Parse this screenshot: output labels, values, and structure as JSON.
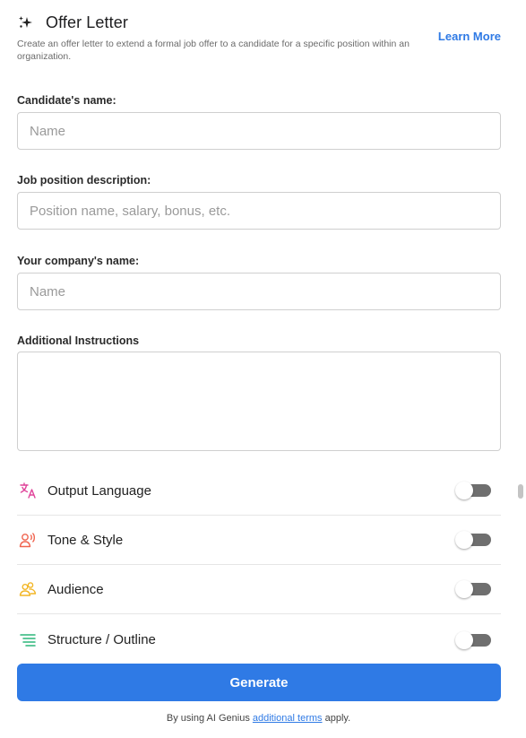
{
  "header": {
    "title": "Offer Letter",
    "subtitle": "Create an offer letter to extend a formal job offer to a candidate for a specific position within an organization.",
    "learn_more": "Learn More",
    "icon": "sparkle-icon"
  },
  "fields": {
    "candidate": {
      "label": "Candidate's name:",
      "placeholder": "Name",
      "value": ""
    },
    "position": {
      "label": "Job position description:",
      "placeholder": "Position name, salary, bonus, etc.",
      "value": ""
    },
    "company": {
      "label": "Your company's name:",
      "placeholder": "Name",
      "value": ""
    },
    "instructions": {
      "label": "Additional Instructions",
      "value": ""
    }
  },
  "options": [
    {
      "label": "Output Language",
      "icon": "translate-icon",
      "enabled": false
    },
    {
      "label": "Tone & Style",
      "icon": "voice-icon",
      "enabled": false
    },
    {
      "label": "Audience",
      "icon": "people-icon",
      "enabled": false
    },
    {
      "label": "Structure / Outline",
      "icon": "outline-icon",
      "enabled": false
    }
  ],
  "generate_label": "Generate",
  "footer": {
    "prefix": "By using AI Genius ",
    "link": "additional terms",
    "suffix": " apply."
  },
  "colors": {
    "accent": "#2f7ae5",
    "toggle_off": "#6f6f6f",
    "language_icon": "#e0449a",
    "tone_icon": "#f0644f",
    "audience_icon": "#f2b626",
    "structure_icon": "#2cb67a"
  }
}
